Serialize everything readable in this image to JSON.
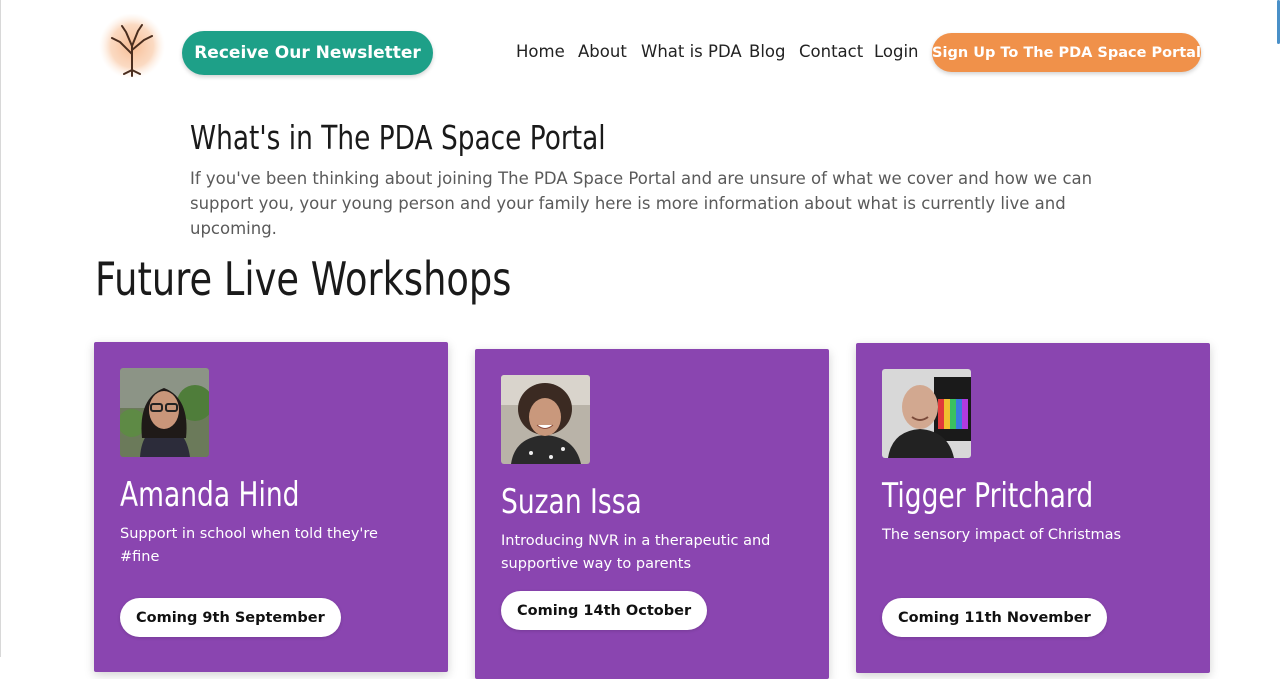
{
  "header": {
    "logo_icon": "tree-icon",
    "newsletter_label": "Receive Our Newsletter",
    "nav": [
      "Home",
      "About",
      "What is PDA",
      "Blog",
      "Contact",
      "Login"
    ],
    "signup_label": "Sign Up To The PDA Space Portal"
  },
  "intro": {
    "title": "What's in The PDA Space Portal",
    "text": "If you've been thinking about joining The PDA Space Portal and are unsure of what we cover and how we can support you, your young person and your family here is more information about what is currently live and upcoming."
  },
  "workshops": {
    "title": "Future Live Workshops",
    "cards": [
      {
        "name": "Amanda Hind",
        "description": "Support in school when told they're #fine",
        "date": "Coming 9th September"
      },
      {
        "name": "Suzan Issa",
        "description": "Introducing NVR in a therapeutic and supportive way to parents",
        "date": "Coming 14th October"
      },
      {
        "name": "Tigger Pritchard",
        "description": "The sensory impact of Christmas",
        "date": "Coming 11th November"
      }
    ]
  },
  "colors": {
    "newsletter_green": "#1ea088",
    "signup_orange": "#f0914a",
    "card_purple": "#8a45b0"
  }
}
